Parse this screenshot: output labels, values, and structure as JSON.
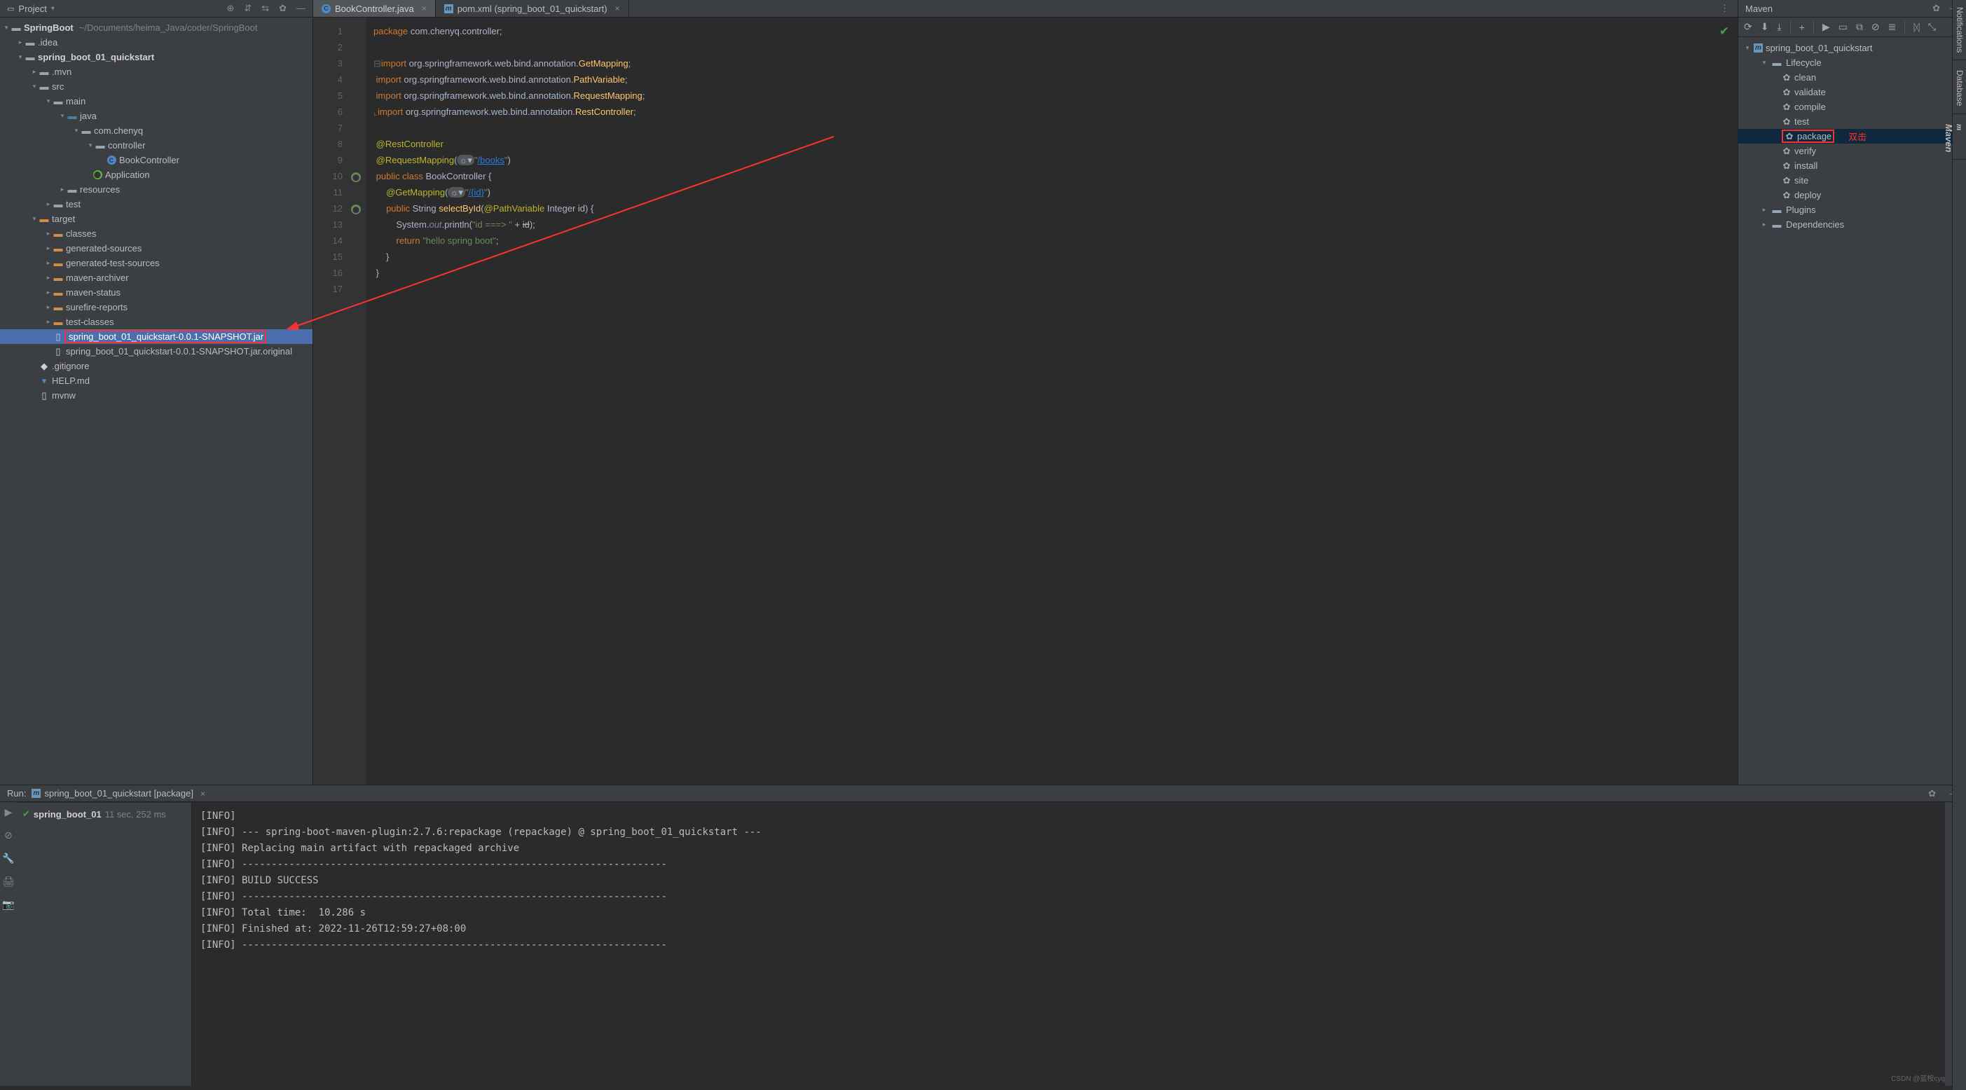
{
  "project_panel": {
    "title": "Project",
    "root_name": "SpringBoot",
    "root_path": "~/Documents/heima_Java/coder/SpringBoot",
    "tree": {
      "idea": ".idea",
      "module": "spring_boot_01_quickstart",
      "mvn": ".mvn",
      "src": "src",
      "main": "main",
      "java": "java",
      "pkg": "com.chenyq",
      "controller": "controller",
      "book_ctrl": "BookController",
      "application": "Application",
      "resources": "resources",
      "test": "test",
      "target": "target",
      "classes": "classes",
      "gen_src": "generated-sources",
      "gen_test_src": "generated-test-sources",
      "maven_arch": "maven-archiver",
      "maven_status": "maven-status",
      "surefire": "surefire-reports",
      "test_classes": "test-classes",
      "jar": "spring_boot_01_quickstart-0.0.1-SNAPSHOT.jar",
      "jar_orig": "spring_boot_01_quickstart-0.0.1-SNAPSHOT.jar.original",
      "gitignore": ".gitignore",
      "help": "HELP.md",
      "mvnw": "mvnw"
    }
  },
  "tabs": {
    "active": "BookController.java",
    "pom": "pom.xml (spring_boot_01_quickstart)"
  },
  "editor": {
    "lines": [
      "1",
      "2",
      "3",
      "4",
      "5",
      "6",
      "7",
      "8",
      "9",
      "10",
      "11",
      "12",
      "13",
      "14",
      "15",
      "16",
      "17"
    ]
  },
  "maven": {
    "title": "Maven",
    "root": "spring_boot_01_quickstart",
    "lifecycle": "Lifecycle",
    "lifecycle_items": [
      "clean",
      "validate",
      "compile",
      "test",
      "package",
      "verify",
      "install",
      "site",
      "deploy"
    ],
    "plugins": "Plugins",
    "deps": "Dependencies",
    "annotation": "双击"
  },
  "run": {
    "title": "Run:",
    "config": "spring_boot_01_quickstart [package]",
    "tree_label": "spring_boot_01",
    "tree_time": "11 sec, 252 ms",
    "output": [
      "[INFO]",
      "[INFO] --- spring-boot-maven-plugin:2.7.6:repackage (repackage) @ spring_boot_01_quickstart ---",
      "[INFO] Replacing main artifact with repackaged archive",
      "[INFO] ------------------------------------------------------------------------",
      "[INFO] BUILD SUCCESS",
      "[INFO] ------------------------------------------------------------------------",
      "[INFO] Total time:  10.286 s",
      "[INFO] Finished at: 2022-11-26T12:59:27+08:00",
      "[INFO] ------------------------------------------------------------------------"
    ]
  },
  "side_tabs": [
    "Notifications",
    "Database",
    "Maven"
  ],
  "watermark": "CSDN @蓝桉cyq"
}
